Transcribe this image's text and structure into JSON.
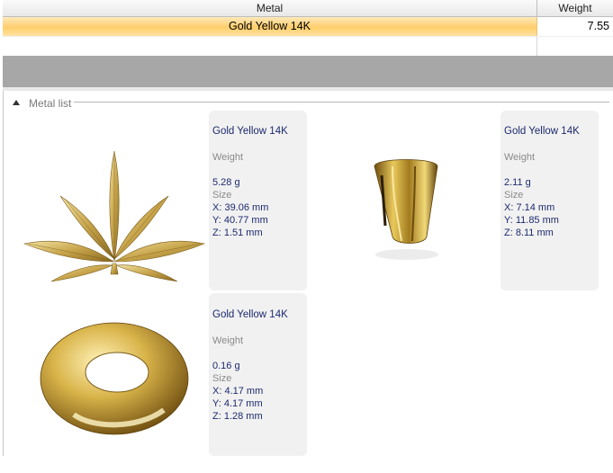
{
  "grid": {
    "columns": {
      "metal": "Metal",
      "weight": "Weight"
    },
    "rows": [
      {
        "metal": "Gold Yellow 14K",
        "weight": "7.55"
      }
    ]
  },
  "metal_list": {
    "title": "Metal list",
    "items": [
      {
        "name": "Gold Yellow 14K",
        "weight_label": "Weight",
        "weight": "5.28 g",
        "size_label": "Size",
        "x": "X: 39.06 mm",
        "y": "Y: 40.77 mm",
        "z": "Z: 1.51 mm",
        "icon": "leaf-pendant"
      },
      {
        "name": "Gold Yellow 14K",
        "weight_label": "Weight",
        "weight": "2.11 g",
        "size_label": "Size",
        "x": "X: 7.14 mm",
        "y": "Y: 11.85 mm",
        "z": "Z: 8.11 mm",
        "icon": "bail"
      },
      {
        "name": "Gold Yellow 14K",
        "weight_label": "Weight",
        "weight": "0.16 g",
        "size_label": "Size",
        "x": "X: 4.17 mm",
        "y": "Y: 4.17 mm",
        "z": "Z: 1.28 mm",
        "icon": "jump-ring"
      }
    ]
  },
  "colors": {
    "selection": "#ffd27a",
    "band": "#a7a7a7",
    "gold": "#c9a43a",
    "text_blue": "#1c2a6e"
  }
}
